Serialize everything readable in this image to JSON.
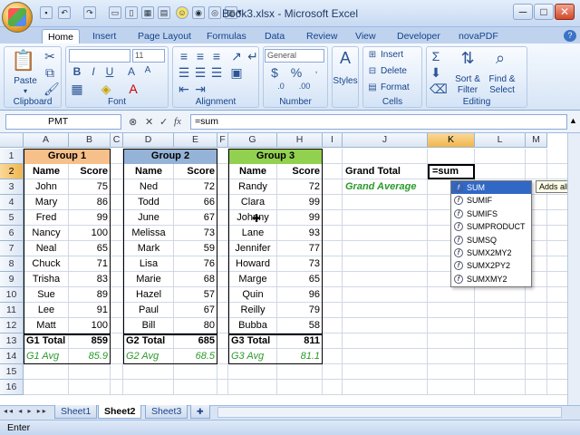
{
  "window": {
    "title": "Book3.xlsx - Microsoft Excel",
    "minimize": "─",
    "maximize": "□",
    "close": "✕"
  },
  "ribbon_tabs": [
    "Home",
    "Insert",
    "Page Layout",
    "Formulas",
    "Data",
    "Review",
    "View",
    "Developer",
    "novaPDF"
  ],
  "ribbon": {
    "clipboard": {
      "label": "Clipboard",
      "paste": "Paste"
    },
    "font": {
      "label": "Font",
      "font_name": "",
      "font_size": "11"
    },
    "alignment": {
      "label": "Alignment"
    },
    "number": {
      "label": "Number",
      "format": "General",
      "currency": "$",
      "percent": "%"
    },
    "styles": {
      "label": "Styles"
    },
    "cells": {
      "label": "Cells",
      "insert": "Insert",
      "delete": "Delete",
      "format": "Format"
    },
    "editing": {
      "label": "Editing",
      "sort": "Sort &",
      "filter": "Filter",
      "find": "Find &",
      "select": "Select"
    }
  },
  "formula_bar": {
    "name_box": "PMT",
    "formula": "=sum"
  },
  "columns": [
    "A",
    "B",
    "C",
    "D",
    "E",
    "F",
    "G",
    "H",
    "I",
    "J",
    "K",
    "L",
    "M"
  ],
  "rows": [
    "1",
    "2",
    "3",
    "4",
    "5",
    "6",
    "7",
    "8",
    "9",
    "10",
    "11",
    "12",
    "13",
    "14",
    "15",
    "16"
  ],
  "groups": [
    {
      "title": "Group 1",
      "name_hdr": "Name",
      "score_hdr": "Score",
      "color": "#f7c08a",
      "rows": [
        [
          "John",
          "75"
        ],
        [
          "Mary",
          "86"
        ],
        [
          "Fred",
          "99"
        ],
        [
          "Nancy",
          "100"
        ],
        [
          "Neal",
          "65"
        ],
        [
          "Chuck",
          "71"
        ],
        [
          "Trisha",
          "83"
        ],
        [
          "Sue",
          "89"
        ],
        [
          "Lee",
          "91"
        ],
        [
          "Matt",
          "100"
        ]
      ],
      "total_label": "G1 Total",
      "total": "859",
      "avg_label": "G1 Avg",
      "avg": "85.9"
    },
    {
      "title": "Group 2",
      "name_hdr": "Name",
      "score_hdr": "Score",
      "color": "#95b3d7",
      "rows": [
        [
          "Ned",
          "72"
        ],
        [
          "Todd",
          "66"
        ],
        [
          "June",
          "67"
        ],
        [
          "Melissa",
          "73"
        ],
        [
          "Mark",
          "59"
        ],
        [
          "Lisa",
          "76"
        ],
        [
          "Marie",
          "68"
        ],
        [
          "Hazel",
          "57"
        ],
        [
          "Paul",
          "67"
        ],
        [
          "Bill",
          "80"
        ]
      ],
      "total_label": "G2 Total",
      "total": "685",
      "avg_label": "G2 Avg",
      "avg": "68.5"
    },
    {
      "title": "Group 3",
      "name_hdr": "Name",
      "score_hdr": "Score",
      "color": "#92d050",
      "rows": [
        [
          "Randy",
          "72"
        ],
        [
          "Clara",
          "99"
        ],
        [
          "Johnny",
          "99"
        ],
        [
          "Lane",
          "93"
        ],
        [
          "Jennifer",
          "77"
        ],
        [
          "Howard",
          "73"
        ],
        [
          "Marge",
          "65"
        ],
        [
          "Quin",
          "96"
        ],
        [
          "Reilly",
          "79"
        ],
        [
          "Bubba",
          "58"
        ]
      ],
      "total_label": "G3 Total",
      "total": "811",
      "avg_label": "G3 Avg",
      "avg": "81.1"
    }
  ],
  "summary": {
    "grand_total_label": "Grand Total",
    "grand_average_label": "Grand Average",
    "editing_cell": "=sum"
  },
  "autocomplete": {
    "items": [
      "SUM",
      "SUMIF",
      "SUMIFS",
      "SUMPRODUCT",
      "SUMSQ",
      "SUMX2MY2",
      "SUMX2PY2",
      "SUMXMY2"
    ],
    "selected_index": 0,
    "tooltip": "Adds all th"
  },
  "sheets": [
    "Sheet1",
    "Sheet2",
    "Sheet3"
  ],
  "active_sheet": 1,
  "status": {
    "mode": "Enter"
  }
}
